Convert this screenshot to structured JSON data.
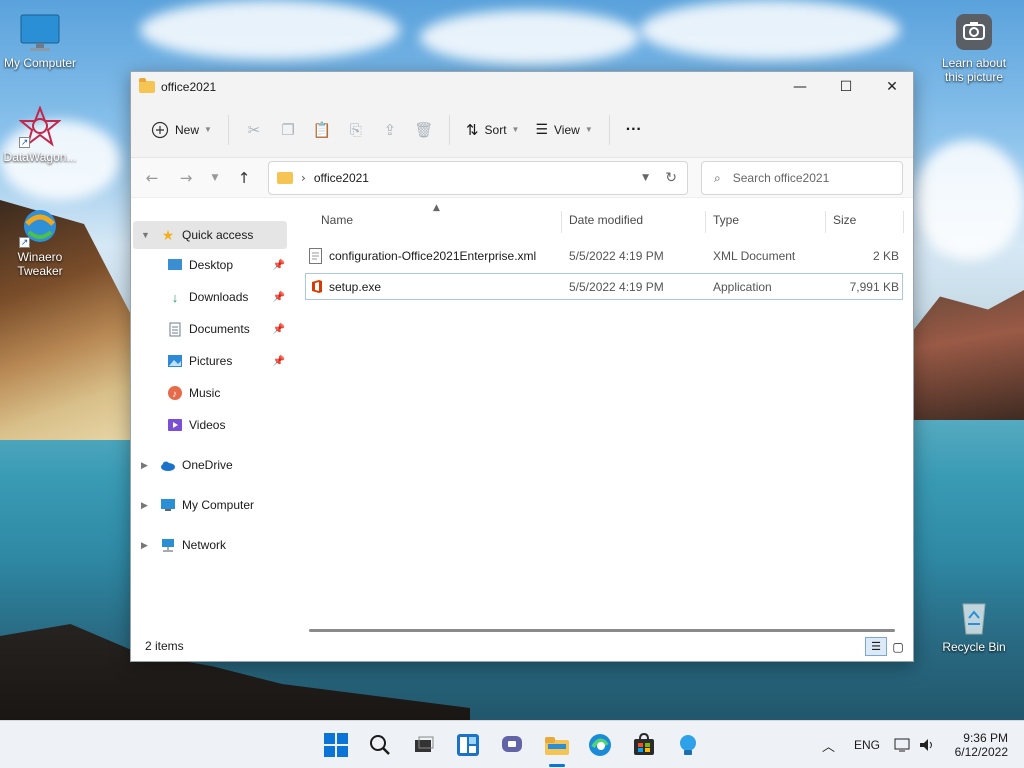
{
  "desktop": {
    "icons": [
      {
        "label": "My Computer"
      },
      {
        "label": "DataWagon..."
      },
      {
        "label": "Winaero Tweaker"
      },
      {
        "label": "Learn about this picture"
      },
      {
        "label": "Recycle Bin"
      }
    ]
  },
  "window": {
    "title": "office2021",
    "controls": {
      "minimize": "—",
      "maximize": "☐",
      "close": "✕"
    }
  },
  "toolbar": {
    "new_label": "New",
    "sort_label": "Sort",
    "view_label": "View",
    "more_label": "···"
  },
  "address": {
    "path": "office2021",
    "search_placeholder": "Search office2021"
  },
  "sidebar": {
    "quick_access": "Quick access",
    "items": [
      {
        "label": "Desktop",
        "pinned": true
      },
      {
        "label": "Downloads",
        "pinned": true
      },
      {
        "label": "Documents",
        "pinned": true
      },
      {
        "label": "Pictures",
        "pinned": true
      },
      {
        "label": "Music",
        "pinned": false
      },
      {
        "label": "Videos",
        "pinned": false
      }
    ],
    "roots": [
      {
        "label": "OneDrive"
      },
      {
        "label": "My Computer"
      },
      {
        "label": "Network"
      }
    ]
  },
  "files": {
    "columns": [
      "Name",
      "Date modified",
      "Type",
      "Size"
    ],
    "rows": [
      {
        "name": "configuration-Office2021Enterprise.xml",
        "date": "5/5/2022 4:19 PM",
        "type": "XML Document",
        "size": "2 KB"
      },
      {
        "name": "setup.exe",
        "date": "5/5/2022 4:19 PM",
        "type": "Application",
        "size": "7,991 KB"
      }
    ]
  },
  "status": {
    "count": "2 items"
  },
  "taskbar": {
    "language": "ENG",
    "time": "9:36 PM",
    "date": "6/12/2022"
  },
  "colors": {
    "accent": "#0067c0",
    "selection_border": "#a9c7e6",
    "folder": "#f5c452",
    "office_red": "#d83b01"
  }
}
